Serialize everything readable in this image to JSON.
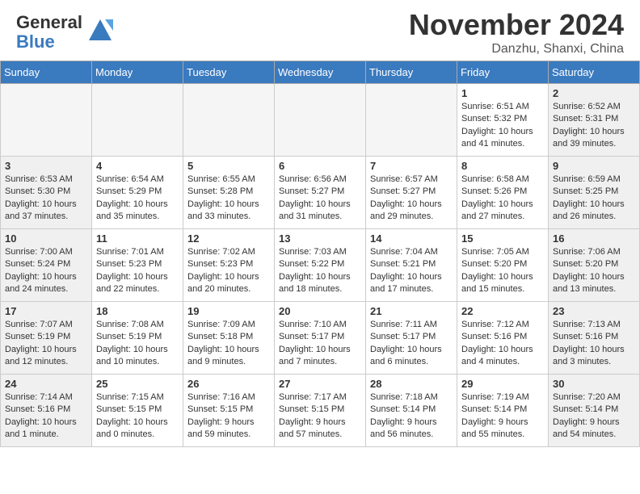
{
  "header": {
    "logo_text_general": "General",
    "logo_text_blue": "Blue",
    "month_title": "November 2024",
    "location": "Danzhu, Shanxi, China"
  },
  "days_of_week": [
    "Sunday",
    "Monday",
    "Tuesday",
    "Wednesday",
    "Thursday",
    "Friday",
    "Saturday"
  ],
  "weeks": [
    [
      {
        "day": "",
        "empty": true
      },
      {
        "day": "",
        "empty": true
      },
      {
        "day": "",
        "empty": true
      },
      {
        "day": "",
        "empty": true
      },
      {
        "day": "",
        "empty": true
      },
      {
        "day": "1",
        "sunrise": "6:51 AM",
        "sunset": "5:32 PM",
        "daylight": "10 hours and 41 minutes."
      },
      {
        "day": "2",
        "sunrise": "6:52 AM",
        "sunset": "5:31 PM",
        "daylight": "10 hours and 39 minutes."
      }
    ],
    [
      {
        "day": "3",
        "sunrise": "6:53 AM",
        "sunset": "5:30 PM",
        "daylight": "10 hours and 37 minutes."
      },
      {
        "day": "4",
        "sunrise": "6:54 AM",
        "sunset": "5:29 PM",
        "daylight": "10 hours and 35 minutes."
      },
      {
        "day": "5",
        "sunrise": "6:55 AM",
        "sunset": "5:28 PM",
        "daylight": "10 hours and 33 minutes."
      },
      {
        "day": "6",
        "sunrise": "6:56 AM",
        "sunset": "5:27 PM",
        "daylight": "10 hours and 31 minutes."
      },
      {
        "day": "7",
        "sunrise": "6:57 AM",
        "sunset": "5:27 PM",
        "daylight": "10 hours and 29 minutes."
      },
      {
        "day": "8",
        "sunrise": "6:58 AM",
        "sunset": "5:26 PM",
        "daylight": "10 hours and 27 minutes."
      },
      {
        "day": "9",
        "sunrise": "6:59 AM",
        "sunset": "5:25 PM",
        "daylight": "10 hours and 26 minutes."
      }
    ],
    [
      {
        "day": "10",
        "sunrise": "7:00 AM",
        "sunset": "5:24 PM",
        "daylight": "10 hours and 24 minutes."
      },
      {
        "day": "11",
        "sunrise": "7:01 AM",
        "sunset": "5:23 PM",
        "daylight": "10 hours and 22 minutes."
      },
      {
        "day": "12",
        "sunrise": "7:02 AM",
        "sunset": "5:23 PM",
        "daylight": "10 hours and 20 minutes."
      },
      {
        "day": "13",
        "sunrise": "7:03 AM",
        "sunset": "5:22 PM",
        "daylight": "10 hours and 18 minutes."
      },
      {
        "day": "14",
        "sunrise": "7:04 AM",
        "sunset": "5:21 PM",
        "daylight": "10 hours and 17 minutes."
      },
      {
        "day": "15",
        "sunrise": "7:05 AM",
        "sunset": "5:20 PM",
        "daylight": "10 hours and 15 minutes."
      },
      {
        "day": "16",
        "sunrise": "7:06 AM",
        "sunset": "5:20 PM",
        "daylight": "10 hours and 13 minutes."
      }
    ],
    [
      {
        "day": "17",
        "sunrise": "7:07 AM",
        "sunset": "5:19 PM",
        "daylight": "10 hours and 12 minutes."
      },
      {
        "day": "18",
        "sunrise": "7:08 AM",
        "sunset": "5:19 PM",
        "daylight": "10 hours and 10 minutes."
      },
      {
        "day": "19",
        "sunrise": "7:09 AM",
        "sunset": "5:18 PM",
        "daylight": "10 hours and 9 minutes."
      },
      {
        "day": "20",
        "sunrise": "7:10 AM",
        "sunset": "5:17 PM",
        "daylight": "10 hours and 7 minutes."
      },
      {
        "day": "21",
        "sunrise": "7:11 AM",
        "sunset": "5:17 PM",
        "daylight": "10 hours and 6 minutes."
      },
      {
        "day": "22",
        "sunrise": "7:12 AM",
        "sunset": "5:16 PM",
        "daylight": "10 hours and 4 minutes."
      },
      {
        "day": "23",
        "sunrise": "7:13 AM",
        "sunset": "5:16 PM",
        "daylight": "10 hours and 3 minutes."
      }
    ],
    [
      {
        "day": "24",
        "sunrise": "7:14 AM",
        "sunset": "5:16 PM",
        "daylight": "10 hours and 1 minute."
      },
      {
        "day": "25",
        "sunrise": "7:15 AM",
        "sunset": "5:15 PM",
        "daylight": "10 hours and 0 minutes."
      },
      {
        "day": "26",
        "sunrise": "7:16 AM",
        "sunset": "5:15 PM",
        "daylight": "9 hours and 59 minutes."
      },
      {
        "day": "27",
        "sunrise": "7:17 AM",
        "sunset": "5:15 PM",
        "daylight": "9 hours and 57 minutes."
      },
      {
        "day": "28",
        "sunrise": "7:18 AM",
        "sunset": "5:14 PM",
        "daylight": "9 hours and 56 minutes."
      },
      {
        "day": "29",
        "sunrise": "7:19 AM",
        "sunset": "5:14 PM",
        "daylight": "9 hours and 55 minutes."
      },
      {
        "day": "30",
        "sunrise": "7:20 AM",
        "sunset": "5:14 PM",
        "daylight": "9 hours and 54 minutes."
      }
    ]
  ]
}
